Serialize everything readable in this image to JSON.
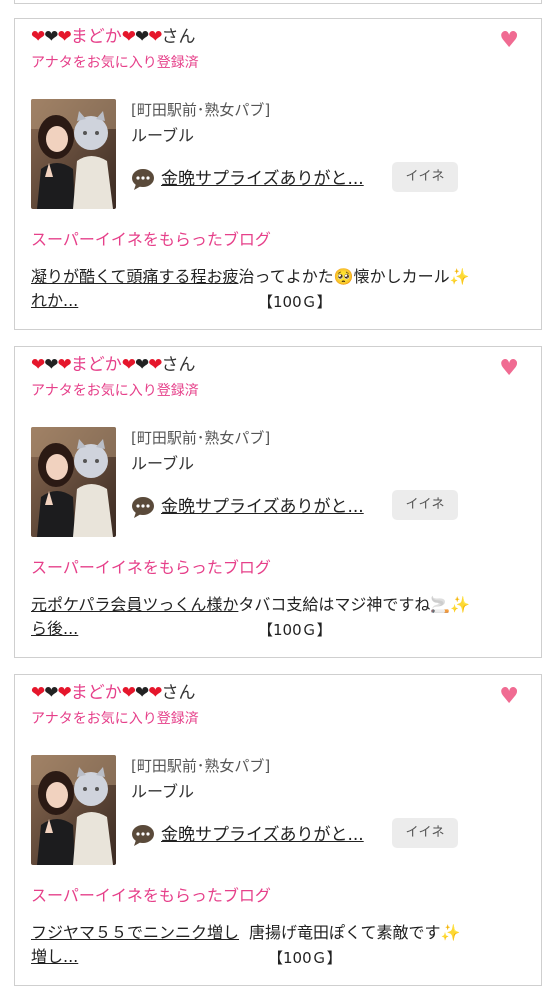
{
  "cards": [
    {
      "user_name": "まどか",
      "san": "さん",
      "fav_status": "アナタをお気に入り登録済",
      "shop_tag": "[町田駅前･熟女パブ]",
      "shop_name": "ルーブル",
      "post_title": "金晩サプライズありがと...",
      "iine_label": "イイネ",
      "super_like_heading": "スーパーイイネをもらったブログ",
      "blog_line1_link": "凝りが酷くて頭痛する程お疲",
      "blog_line1_rest": "治ってよかた🥺懐かしカール✨",
      "blog_line2_link": "れか...",
      "blog_cost": "【100Ｇ】"
    },
    {
      "user_name": "まどか",
      "san": "さん",
      "fav_status": "アナタをお気に入り登録済",
      "shop_tag": "[町田駅前･熟女パブ]",
      "shop_name": "ルーブル",
      "post_title": "金晩サプライズありがと...",
      "iine_label": "イイネ",
      "super_like_heading": "スーパーイイネをもらったブログ",
      "blog_line1_link": "元ポケパラ会員ツっくん様か",
      "blog_line1_rest": "タバコ支給はマジ神ですね🚬✨",
      "blog_line2_link": "ら後...",
      "blog_cost": "【100Ｇ】"
    },
    {
      "user_name": "まどか",
      "san": "さん",
      "fav_status": "アナタをお気に入り登録済",
      "shop_tag": "[町田駅前･熟女パブ]",
      "shop_name": "ルーブル",
      "post_title": "金晩サプライズありがと...",
      "iine_label": "イイネ",
      "super_like_heading": "スーパーイイネをもらったブログ",
      "blog_line1_link": "フジヤマ５５でニンニク増し",
      "blog_line1_rest": "唐揚げ竜田ぽくて素敵です✨",
      "blog_line2_link": "増し...",
      "blog_cost": "【100Ｇ】"
    }
  ],
  "colors": {
    "pink_text": "#e6408a",
    "heart_red": "#e5162b",
    "heart_black": "#222222",
    "fav_heart": "#f06b92",
    "border": "#cfcfcf",
    "button_bg": "#ececec"
  }
}
